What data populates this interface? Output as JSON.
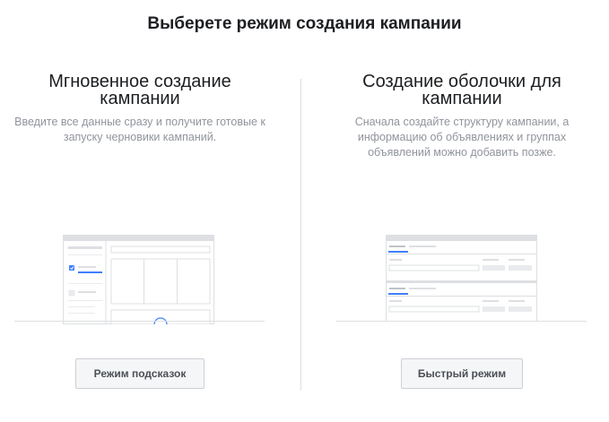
{
  "page": {
    "title": "Выберете режим создания кампании"
  },
  "options": [
    {
      "heading": "Мгновенное создание кампании",
      "description": "Введите все данные сразу и получите готовые к запуску черновики кампаний.",
      "button_label": "Режим подсказок"
    },
    {
      "heading": "Создание оболочки для кампании",
      "description": "Сначала создайте структуру кампании, а информацию об объявлениях и группах объявлений можно добавить позже.",
      "button_label": "Быстрый режим"
    }
  ],
  "colors": {
    "accent": "#4080ff",
    "divider": "#dddfe2",
    "muted_text": "#90949c",
    "button_bg": "#f5f6f7"
  }
}
